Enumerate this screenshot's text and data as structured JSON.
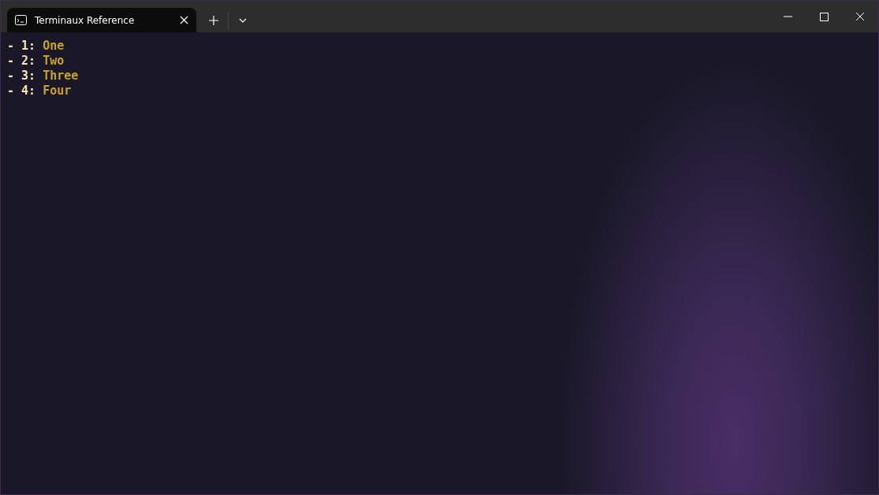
{
  "tab": {
    "title": "Terminaux Reference",
    "selected": true
  },
  "lines": [
    {
      "prefix": "- 1:",
      "value": "One"
    },
    {
      "prefix": "- 2:",
      "value": "Two"
    },
    {
      "prefix": "- 3:",
      "value": "Three"
    },
    {
      "prefix": "- 4:",
      "value": "Four"
    }
  ]
}
